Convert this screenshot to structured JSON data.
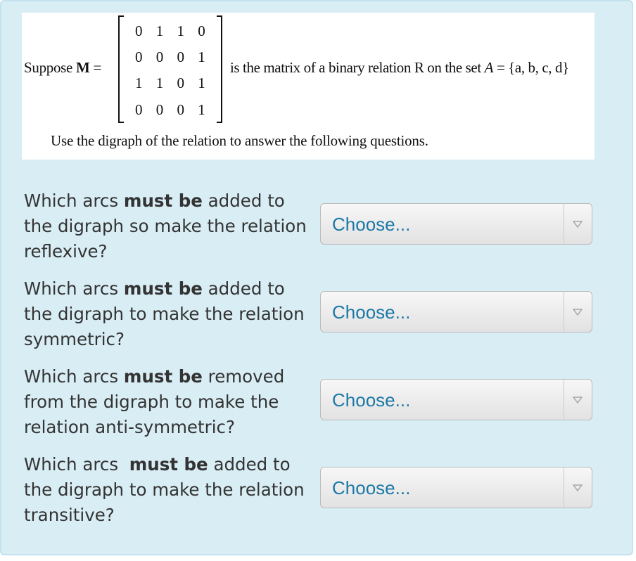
{
  "problem": {
    "suppose_prefix": "Suppose",
    "matrix_symbol": "M",
    "equals": "=",
    "matrix_rows": [
      "0 1 1 0",
      "0 0 0 1",
      "1 1 0 1",
      "0 0 0 1"
    ],
    "relation_text": "is the matrix of a binary relation R on the set",
    "set_name": "A",
    "set_value": "= {a, b, c, d}",
    "instruction": "Use the digraph of the relation to answer the following questions."
  },
  "questions": [
    {
      "before": "Which arcs ",
      "bold": "must be",
      "after": " added to the digraph so make the relation reflexive?",
      "select_value": "Choose..."
    },
    {
      "before": "Which arcs ",
      "bold": "must be",
      "after": " added to the digraph to make the relation symmetric?",
      "select_value": "Choose..."
    },
    {
      "before": "Which arcs ",
      "bold": "must be",
      "after": " removed from the digraph to make the relation anti-symmetric?",
      "select_value": "Choose..."
    },
    {
      "before": "Which arcs  ",
      "bold": "must be",
      "after": " added to the digraph to make the relation transitive?",
      "select_value": "Choose..."
    }
  ],
  "colors": {
    "panel_bg": "#d9edf5",
    "select_text": "#1c78a6",
    "question_text": "#333333"
  },
  "icons": {
    "select_arrow": "triangle-down-icon"
  }
}
